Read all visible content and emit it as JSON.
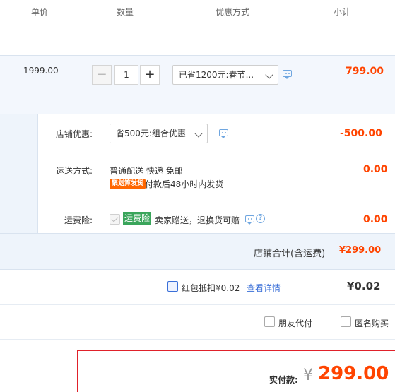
{
  "header": {
    "col_price": "单价",
    "col_qty": "数量",
    "col_promo": "优惠方式",
    "col_subtotal": "小计"
  },
  "item": {
    "unit_price": "1999.00",
    "minus": "−",
    "quantity": "1",
    "plus": "+",
    "promo_selected": "已省1200元:春节...",
    "subtotal": "799.00"
  },
  "shop": {
    "discount_label": "店铺优惠:",
    "discount_selected": "省500元:组合优惠",
    "discount_amount": "-500.00",
    "shipping_label": "运送方式:",
    "shipping_method": "普通配送 快递 免邮",
    "shipping_badge": "聚划算发货",
    "shipping_note": "付款后48小时内发货",
    "shipping_amount": "0.00",
    "insurance_label": "运费险:",
    "insurance_badge": "运费险",
    "insurance_text": "卖家赠送，退换货可赔",
    "insurance_help": "?",
    "insurance_amount": "0.00"
  },
  "shop_total": {
    "label": "店铺合计(含运费)",
    "amount": "¥299.00"
  },
  "redpacket": {
    "label": "红包抵扣¥0.02",
    "details_link": "查看详情",
    "amount": "¥0.02"
  },
  "options": {
    "friend_pay": "朋友代付",
    "anonymous": "匿名购买"
  },
  "payment": {
    "label": "实付款:",
    "currency": "¥",
    "amount": "299.00"
  },
  "colors": {
    "accent": "#ff4400",
    "link": "#3a6fd8",
    "panel": "#eef4fb",
    "pay_border": "#e0212a"
  }
}
